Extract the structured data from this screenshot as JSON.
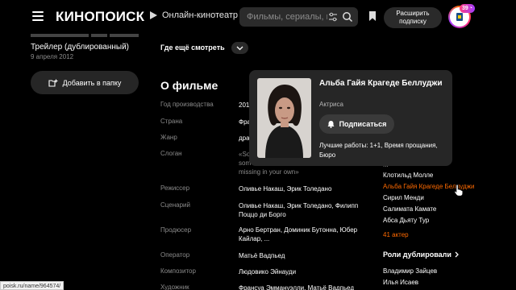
{
  "header": {
    "logo": "КИНОПОИСК",
    "online_label": "Онлайн-кинотеатр",
    "search_placeholder": "Фильмы, сериалы, персоны",
    "subscribe_line1": "Расширить",
    "subscribe_line2": "подписку",
    "badge_count": "39"
  },
  "left": {
    "trailer_title": "Трейлер (дублированный)",
    "trailer_date": "9 апреля 2012",
    "add_folder_label": "Добавить в папку"
  },
  "where_to_watch": "Где ещё смотреть",
  "about": {
    "title": "О фильме",
    "rows": [
      {
        "label": "Год производства",
        "value": "201"
      },
      {
        "label": "Страна",
        "value": "Фра"
      },
      {
        "label": "Жанр",
        "value": "дра"
      },
      {
        "label": "Слоган",
        "value1": "«So",
        "value2": "som",
        "value3": "missing in your own»"
      },
      {
        "label": "Режиссер",
        "value": "Оливье Накаш, Эрик Толедано"
      },
      {
        "label": "Сценарий",
        "value1": "Оливье Накаш, Эрик Толедано, Филипп",
        "value2": "Поццо ди Борго"
      },
      {
        "label": "Продюсер",
        "value1": "Арно Бертран, Доминик Бутонна, Юбер",
        "value2": "Кайлар, ..."
      },
      {
        "label": "Оператор",
        "value": "Матьё Вадпьед"
      },
      {
        "label": "Композитор",
        "value": "Людовико Эйнауди"
      },
      {
        "label": "Художник",
        "value": "Франсуа Эммануэлли, Матьё Вадпьед"
      }
    ]
  },
  "cast": {
    "partial_top": "...",
    "items": [
      "Клотильд Молле",
      "Альба Гайя Крагеде Беллуджи",
      "Сирил Менди",
      "Салимата Камате",
      "Абса Дьяту Тур"
    ],
    "more_label": "41 актер",
    "dubbing_title": "Роли дублировали",
    "dubbing": [
      "Владимир Зайцев",
      "Илья Исаев"
    ]
  },
  "popup": {
    "name": "Альба Гайя Крагеде Беллуджи",
    "role": "Актриса",
    "subscribe_label": "Подписаться",
    "best_works": "Лучшие работы: 1+1, Время прощания, Бюро"
  },
  "status_url": "poisk.ru/name/964574/",
  "colors": {
    "accent": "#ff6a00",
    "background": "#000000",
    "surface": "#262626"
  }
}
